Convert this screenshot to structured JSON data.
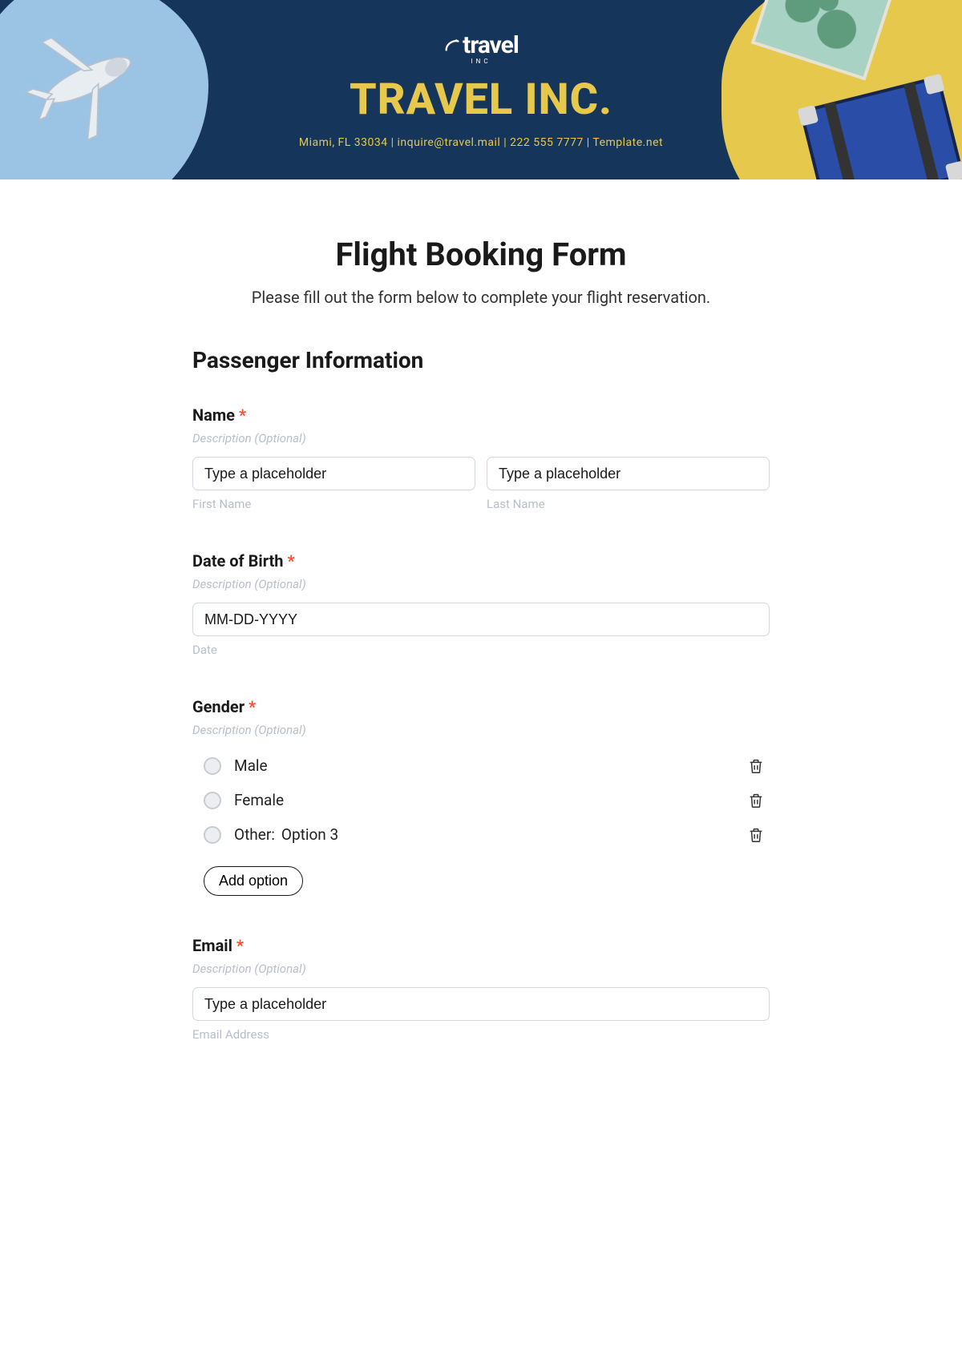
{
  "banner": {
    "logo_text": "travel",
    "logo_sub": "INC",
    "title": "TRAVEL INC.",
    "info": "Miami, FL 33034 | inquire@travel.mail | 222 555 7777 | Template.net"
  },
  "form": {
    "title": "Flight Booking Form",
    "subtitle": "Please fill out the form below to complete your flight reservation.",
    "section": "Passenger Information",
    "desc_placeholder": "Description (Optional)",
    "input_placeholder": "Type a placeholder",
    "name": {
      "label": "Name",
      "first_sub": "First Name",
      "last_sub": "Last Name"
    },
    "dob": {
      "label": "Date of Birth",
      "placeholder": "MM-DD-YYYY",
      "sub": "Date"
    },
    "gender": {
      "label": "Gender",
      "options": [
        {
          "label": "Male"
        },
        {
          "label": "Female"
        },
        {
          "label": "Other:",
          "extra": "Option 3"
        }
      ],
      "add_option": "Add option"
    },
    "email": {
      "label": "Email",
      "sub": "Email Address"
    }
  }
}
